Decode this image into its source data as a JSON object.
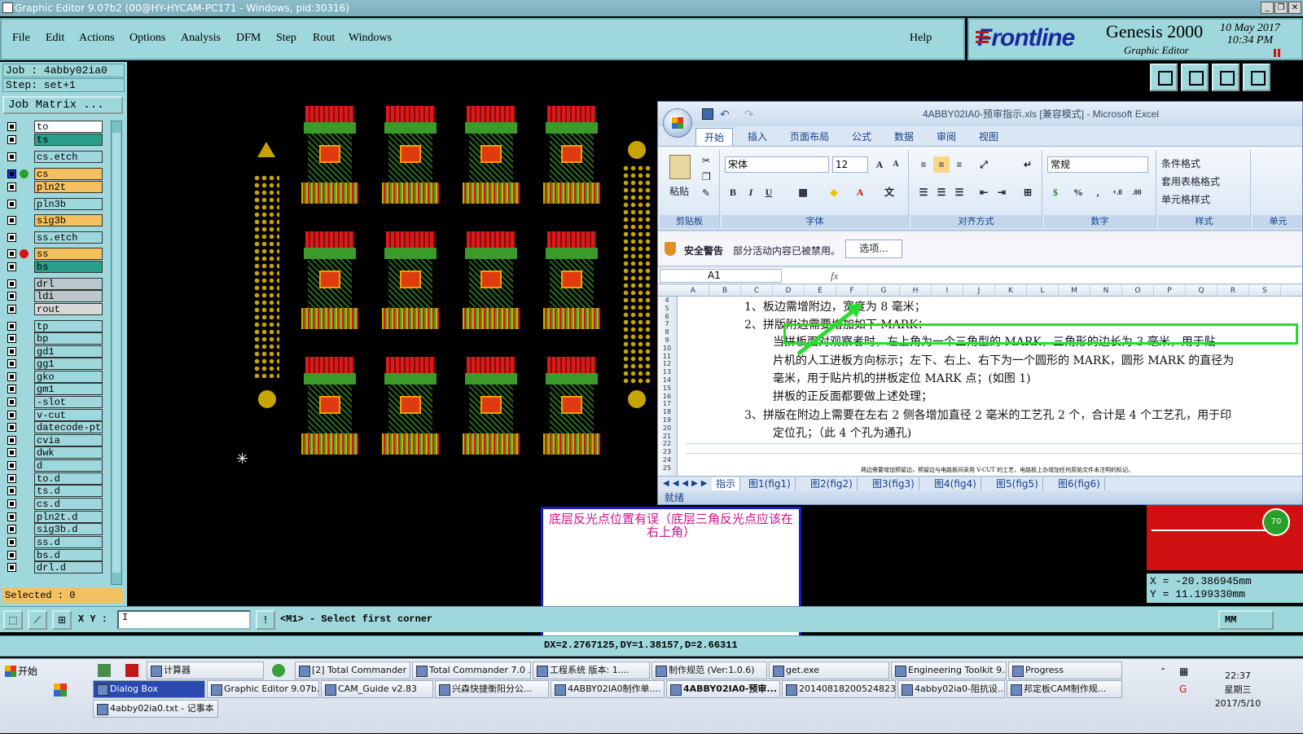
{
  "window": {
    "title": "Graphic Editor 9.07b2 (00@HY-HYCAM-PC171 - Windows, pid:30316)"
  },
  "menu": [
    "File",
    "Edit",
    "Actions",
    "Options",
    "Analysis",
    "DFM",
    "Step",
    "Rout",
    "Windows"
  ],
  "help_label": "Help",
  "brand": {
    "logo": "Frontline",
    "product": "Genesis 2000",
    "subtitle": "Graphic Editor",
    "date": "10 May 2017",
    "time": "10:34 PM"
  },
  "job": {
    "job_line": "Job : 4abby02ia0",
    "step_line": "Step: set+1",
    "matrix_label": "Job Matrix ..."
  },
  "layers": [
    {
      "name": "to",
      "color": "#ffffff",
      "dot": ""
    },
    {
      "name": "ts",
      "color": "#2aa088",
      "dot": ""
    },
    {
      "name": "cs.etch",
      "color": "#9fd8dc",
      "dot": ""
    },
    {
      "name": "cs",
      "color": "#f5c060",
      "dot": "#2aa02a",
      "flag": "blue"
    },
    {
      "name": "pln2t",
      "color": "#f5c060",
      "dot": ""
    },
    {
      "name": "pln3b",
      "color": "#9fd8dc",
      "dot": ""
    },
    {
      "name": "sig3b",
      "color": "#f5c060",
      "dot": ""
    },
    {
      "name": "ss.etch",
      "color": "#9fd8dc",
      "dot": ""
    },
    {
      "name": "ss",
      "color": "#f5c060",
      "dot": "#e01010"
    },
    {
      "name": "bs",
      "color": "#2aa088",
      "dot": ""
    },
    {
      "name": "drl",
      "color": "#b8c8cc",
      "dot": ""
    },
    {
      "name": "ldi",
      "color": "#b8c8cc",
      "dot": ""
    },
    {
      "name": "rout",
      "color": "#d8d8d8",
      "dot": ""
    },
    {
      "name": "tp",
      "color": "#9fd8dc",
      "dot": ""
    },
    {
      "name": "bp",
      "color": "#9fd8dc",
      "dot": ""
    },
    {
      "name": "gd1",
      "color": "#9fd8dc",
      "dot": ""
    },
    {
      "name": "gg1",
      "color": "#9fd8dc",
      "dot": ""
    },
    {
      "name": "gko",
      "color": "#9fd8dc",
      "dot": ""
    },
    {
      "name": "gm1",
      "color": "#9fd8dc",
      "dot": ""
    },
    {
      "name": "-slot",
      "color": "#9fd8dc",
      "dot": ""
    },
    {
      "name": "v-cut",
      "color": "#9fd8dc",
      "dot": ""
    },
    {
      "name": "datecode-pt",
      "color": "#9fd8dc",
      "dot": ""
    },
    {
      "name": "cvia",
      "color": "#9fd8dc",
      "dot": ""
    },
    {
      "name": "dwk",
      "color": "#9fd8dc",
      "dot": ""
    },
    {
      "name": "d",
      "color": "#9fd8dc",
      "dot": ""
    },
    {
      "name": "to.d",
      "color": "#9fd8dc",
      "dot": ""
    },
    {
      "name": "ts.d",
      "color": "#9fd8dc",
      "dot": ""
    },
    {
      "name": "cs.d",
      "color": "#9fd8dc",
      "dot": ""
    },
    {
      "name": "pln2t.d",
      "color": "#9fd8dc",
      "dot": ""
    },
    {
      "name": "sig3b.d",
      "color": "#9fd8dc",
      "dot": ""
    },
    {
      "name": "ss.d",
      "color": "#9fd8dc",
      "dot": ""
    },
    {
      "name": "bs.d",
      "color": "#9fd8dc",
      "dot": ""
    },
    {
      "name": "drl.d",
      "color": "#9fd8dc",
      "dot": ""
    }
  ],
  "selected_label": "Selected : 0",
  "excel": {
    "title": "4ABBY02IA0-预审指示.xls  [兼容模式] - Microsoft Excel",
    "tabs": [
      "开始",
      "插入",
      "页面布局",
      "公式",
      "数据",
      "审阅",
      "视图"
    ],
    "paste_label": "粘贴",
    "font_name": "宋体",
    "font_size": "12",
    "number_format": "常规",
    "style_items": [
      "条件格式",
      "套用表格格式",
      "单元格样式"
    ],
    "groups": [
      "剪贴板",
      "字体",
      "对齐方式",
      "数字",
      "样式",
      "单元"
    ],
    "security_title": "安全警告",
    "security_msg": "部分活动内容已被禁用。",
    "security_btn": "选项...",
    "name_box": "A1",
    "columns": [
      "A",
      "B",
      "C",
      "D",
      "E",
      "F",
      "G",
      "H",
      "I",
      "J",
      "K",
      "L",
      "M",
      "N",
      "O",
      "P",
      "Q",
      "R",
      "S"
    ],
    "rows": [
      "4",
      "5",
      "6",
      "7",
      "8",
      "9",
      "10",
      "11",
      "12",
      "13",
      "14",
      "15",
      "16",
      "17",
      "18",
      "19",
      "20",
      "21",
      "22",
      "23",
      "24",
      "25"
    ],
    "lines": [
      "1、板边需增附边，宽度为 8 毫米；",
      "2、拼版附边需要增加如下 MARK：",
      "当拼板面对观察者时，左上角为一个三角型的 MARK，三角形的边长为 3 毫米，用于贴",
      "片机的人工进板方向标示；左下、右上、右下为一个圆形的 MARK，圆形 MARK 的直径为",
      "毫米，用于贴片机的拼板定位 MARK 点；(如图 1)",
      "拼板的正反面都要做上述处理；",
      "3、拼版在附边上需要在左右 2 侧各增加直径 2 毫米的工艺孔 2 个，合计是 4 个工艺孔，用于印",
      "定位孔；（此 4 个孔为通孔)",
      "两边需要增加预留边，预留边与电路板间采用 V-CUT 的工艺，电路板上办增加任何原始文件未注明的标记。"
    ],
    "sheet_tabs": [
      "指示",
      "图1(fig1)",
      "图2(fig2)",
      "图3(fig3)",
      "图4(fig4)",
      "图5(fig5)",
      "图6(fig6)"
    ],
    "status": "就绪"
  },
  "annotation": "底层反光点位置有误（底层三角反光点应该在右上角）",
  "coords": {
    "x": "X  =  -20.386945mm",
    "y": "Y  =  11.199330mm"
  },
  "gauge_label": "70",
  "command": {
    "xy_label": "X Y :",
    "xy_value": "I",
    "prompt": "<M1> - Select first corner",
    "units": "MM"
  },
  "measure": "DX=2.2767125,DY=1.38157,D=2.66311",
  "taskbar": {
    "start": "开始",
    "row1": [
      "计算器",
      "[2] Total Commander ...",
      "Total Commander 7.0 ...",
      "工程系统  版本: 1....",
      "制作规范 (Ver:1.0.6)",
      "get.exe",
      "Engineering Toolkit 9....",
      "Progress"
    ],
    "row2": [
      "Dialog Box",
      "Graphic Editor 9.07b...",
      "CAM_Guide v2.83",
      "兴森快捷衡阳分公...",
      "4ABBY02IA0制作单....",
      "4ABBY02IA0-预审...",
      "20140818200524823...",
      "4abby02ia0-阻抗设...",
      "邦定板CAM制作规..."
    ],
    "row3": [
      "4abby02ia0.txt - 记事本"
    ],
    "time": "22:37",
    "weekday": "星期三",
    "date": "2017/5/10"
  }
}
